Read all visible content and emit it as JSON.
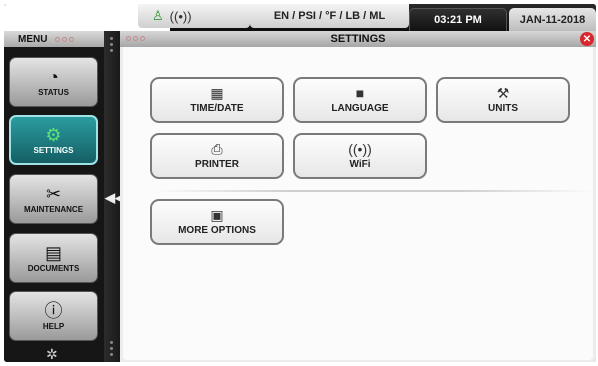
{
  "topbar": {
    "units": "EN / PSI / °F / LB / ML",
    "time": "03:21 PM",
    "date": "JAN-11-2018",
    "icons": [
      "signal-person-icon",
      "wireless-icon"
    ]
  },
  "sidebar": {
    "title": "MENU",
    "items": [
      {
        "label": "STATUS",
        "icon": "gauge-icon"
      },
      {
        "label": "SETTINGS",
        "icon": "gear-icon",
        "active": true
      },
      {
        "label": "MAINTENANCE",
        "icon": "tools-icon"
      },
      {
        "label": "DOCUMENTS",
        "icon": "document-icon"
      },
      {
        "label": "HELP",
        "icon": "help-icon"
      }
    ]
  },
  "panel": {
    "title": "SETTINGS",
    "options": [
      {
        "label": "TIME/DATE",
        "icon": "calendar-clock-icon"
      },
      {
        "label": "LANGUAGE",
        "icon": "language-icon"
      },
      {
        "label": "UNITS",
        "icon": "wrench-icon"
      },
      {
        "label": "PRINTER",
        "icon": "printer-icon"
      },
      {
        "label": "WiFi",
        "icon": "wifi-icon"
      },
      {
        "label": "MORE OPTIONS",
        "icon": "more-options-icon"
      }
    ]
  },
  "colors": {
    "active_nav": "#1f7e84",
    "close": "#d8262c",
    "accent_green": "#5de07a"
  }
}
